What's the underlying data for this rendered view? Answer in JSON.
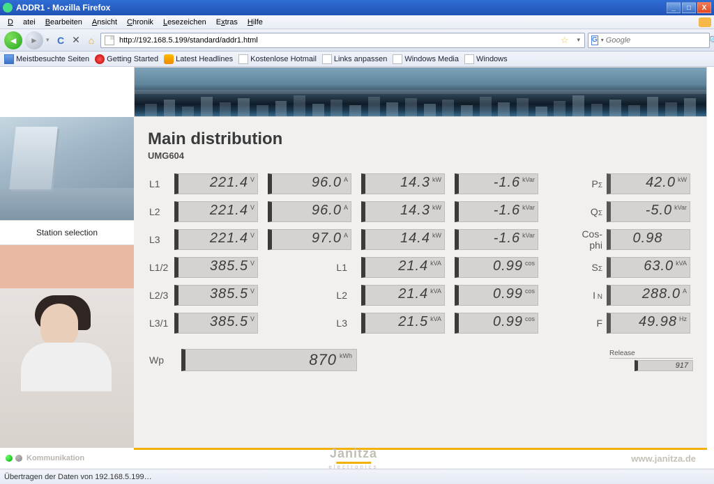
{
  "window": {
    "title": "ADDR1 - Mozilla Firefox"
  },
  "menu": {
    "datei": "Datei",
    "bearbeiten": "Bearbeiten",
    "ansicht": "Ansicht",
    "chronik": "Chronik",
    "lesezeichen": "Lesezeichen",
    "extras": "Extras",
    "hilfe": "Hilfe"
  },
  "url": "http://192.168.5.199/standard/addr1.html",
  "search_placeholder": "Google",
  "bookmarks": {
    "meist": "Meistbesuchte Seiten",
    "getting": "Getting Started",
    "latest": "Latest Headlines",
    "hotmail": "Kostenlose Hotmail",
    "links": "Links anpassen",
    "media": "Windows Media",
    "windows": "Windows"
  },
  "statusbar": "Übertragen der Daten von 192.168.5.199…",
  "sidebar": {
    "station": "Station selection"
  },
  "page": {
    "title": "Main distribution",
    "subtitle": "UMG604"
  },
  "labels": {
    "L1": "L1",
    "L2": "L2",
    "L3": "L3",
    "L12": "L1/2",
    "L23": "L2/3",
    "L31": "L3/1",
    "Psum": "P",
    "Qsum": "Q",
    "Cos": "Cos-phi",
    "Ssum": "S",
    "IN": "I",
    "F": "F",
    "Wp": "Wp",
    "release": "Release"
  },
  "units": {
    "V": "V",
    "A": "A",
    "kW": "kW",
    "kVar": "kVar",
    "kVA": "kVA",
    "cos": "cos",
    "Hz": "Hz",
    "kWh": "kWh"
  },
  "rows": {
    "L1": {
      "v": "221.4",
      "a": "96.0",
      "kw": "14.3",
      "kvar": "-1.6"
    },
    "L2": {
      "v": "221.4",
      "a": "96.0",
      "kw": "14.3",
      "kvar": "-1.6"
    },
    "L3": {
      "v": "221.4",
      "a": "97.0",
      "kw": "14.4",
      "kvar": "-1.6"
    },
    "L12": {
      "v": "385.5",
      "l": "L1",
      "kva": "21.4",
      "cos": "0.99"
    },
    "L23": {
      "v": "385.5",
      "l": "L2",
      "kva": "21.4",
      "cos": "0.99"
    },
    "L31": {
      "v": "385.5",
      "l": "L3",
      "kva": "21.5",
      "cos": "0.99"
    }
  },
  "sum": {
    "P": {
      "v": "42.0",
      "u": "kW"
    },
    "Q": {
      "v": "-5.0",
      "u": "kVar"
    },
    "Cos": {
      "v": "0.98",
      "u": ""
    },
    "S": {
      "v": "63.0",
      "u": "kVA"
    },
    "IN": {
      "v": "288.0",
      "u": "A"
    },
    "F": {
      "v": "49.98",
      "u": "Hz"
    }
  },
  "wp": "870",
  "release": "917",
  "footer": {
    "komm": "Kommunikation",
    "brand": "Janitza",
    "brandsub": "electronics",
    "site": "www.janitza.de"
  }
}
